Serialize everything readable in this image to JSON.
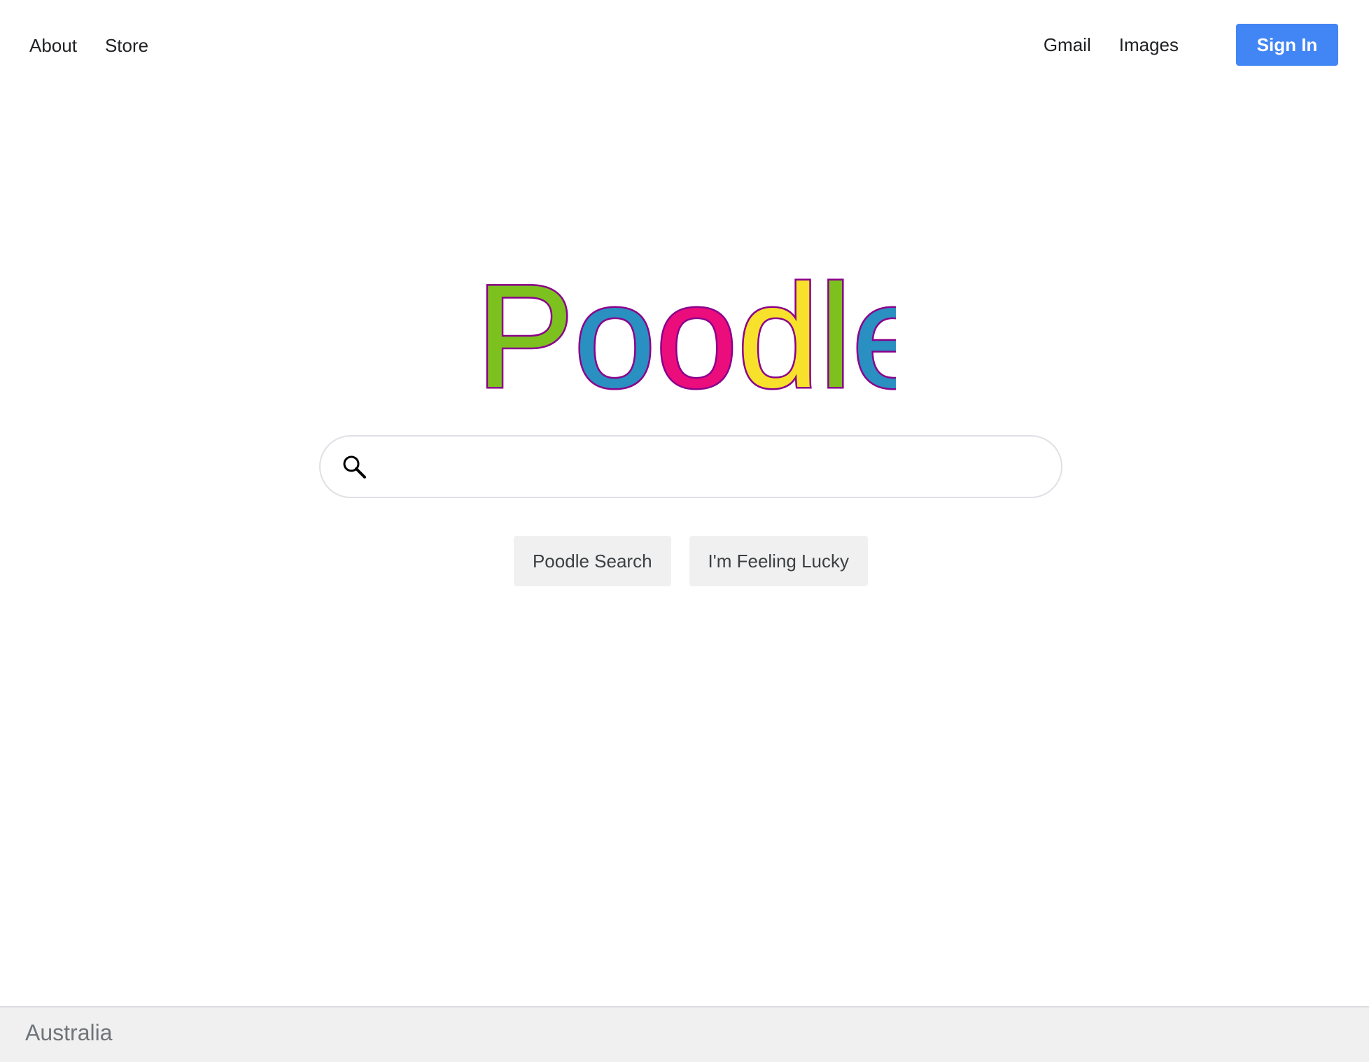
{
  "nav": {
    "left": [
      {
        "label": "About"
      },
      {
        "label": "Store"
      }
    ],
    "right": [
      {
        "label": "Gmail"
      },
      {
        "label": "Images"
      }
    ],
    "signin_label": "Sign In"
  },
  "logo": {
    "text": "Poodle",
    "letters": [
      {
        "char": "P",
        "color": "#7dc11f"
      },
      {
        "char": "o",
        "color": "#2a8fc1"
      },
      {
        "char": "o",
        "color": "#ec0d7d"
      },
      {
        "char": "d",
        "color": "#f8e12b"
      },
      {
        "char": "l",
        "color": "#7dc11f"
      },
      {
        "char": "e",
        "color": "#2a8fc1"
      }
    ],
    "outline_color": "#8b008b"
  },
  "search": {
    "value": "",
    "placeholder": "",
    "icon": "magnifier"
  },
  "buttons": {
    "search_label": "Poodle Search",
    "lucky_label": "I'm Feeling Lucky"
  },
  "footer": {
    "location": "Australia"
  },
  "colors": {
    "signin_bg": "#4285f4",
    "button_bg": "#f0f0f0",
    "footer_bg": "#f0f0f0"
  }
}
